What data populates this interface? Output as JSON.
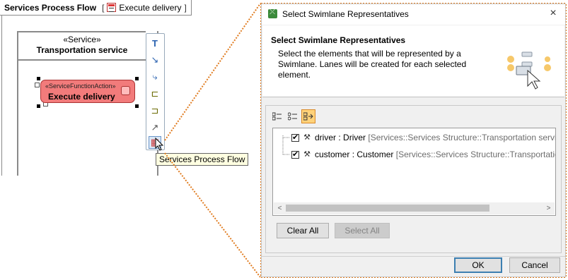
{
  "diagram": {
    "tab_title": "Services Process Flow",
    "bracket_open": "[",
    "bracket_close": "]",
    "tab_ref_label": "Execute delivery",
    "lane_stereotype": "«Service»",
    "lane_name": "Transportation service",
    "action_stereotype": "«ServiceFunctionAction»",
    "action_name": "Execute delivery",
    "tooltip": "Services Process Flow"
  },
  "colors": {
    "action_fill": "#f27b7b",
    "connector": "#e07b1f",
    "tooltip_bg": "#ffffe1",
    "default_button_border": "#3c7fb1"
  },
  "dialog": {
    "title": "Select Swimlane Representatives",
    "close_icon": "×",
    "header_title": "Select Swimlane Representatives",
    "header_description": "Select the elements that will be represented by a Swimlane. Lanes will be created for each selected element.",
    "toolbar": [
      {
        "icon": "expand-tree-icon"
      },
      {
        "icon": "collapse-tree-icon"
      },
      {
        "icon": "show-qualified-icon",
        "active": true
      }
    ],
    "items": [
      {
        "checked": true,
        "name": "driver",
        "sep": " : ",
        "type": "Driver",
        "qualified": "[Services::Services Structure::Transportation service]"
      },
      {
        "checked": true,
        "name": "customer",
        "sep": " : ",
        "type": "Customer",
        "qualified": "[Services::Services Structure::Transportation service]"
      }
    ],
    "scroll_left": "<",
    "scroll_right": ">",
    "clear_all_label": "Clear All",
    "select_all_label": "Select All",
    "ok_label": "OK",
    "cancel_label": "Cancel"
  }
}
